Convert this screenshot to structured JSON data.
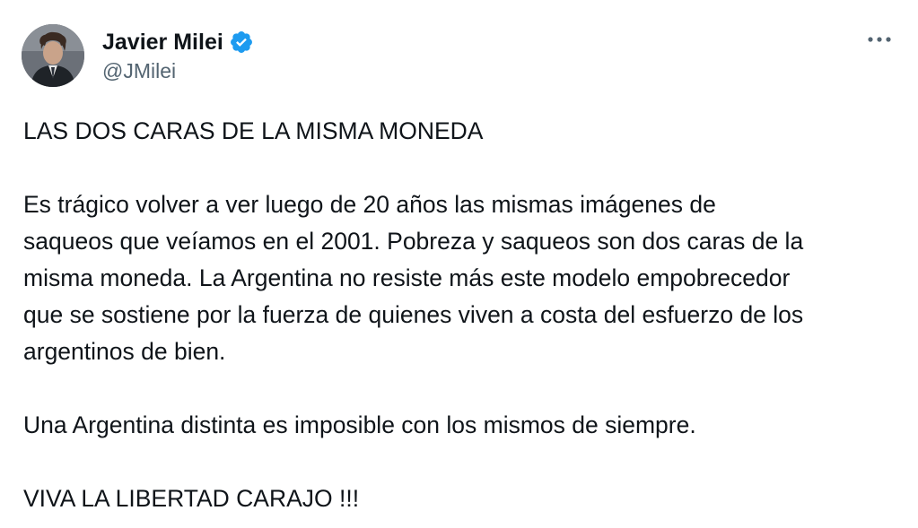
{
  "author": {
    "display_name": "Javier Milei",
    "handle": "@JMilei",
    "verified_icon": "verified-badge-icon",
    "avatar_icon": "avatar"
  },
  "menu": {
    "more_icon": "more-options-icon"
  },
  "colors": {
    "text": "#0f1419",
    "secondary_text": "#536471",
    "verified_blue": "#1d9bf0",
    "background": "#ffffff"
  },
  "tweet": {
    "title": "LAS DOS CARAS DE LA MISMA MONEDA",
    "paragraph_1_lines": [
      "Es trágico volver a ver luego de 20 años las mismas imágenes de",
      "saqueos que veíamos en el 2001. Pobreza y saqueos son dos caras de la",
      "misma moneda. La Argentina no resiste más este modelo empobrecedor",
      "que se sostiene por la fuerza de quienes viven a costa del esfuerzo de los",
      "argentinos de bien."
    ],
    "paragraph_2": "Una Argentina distinta es imposible con los mismos de siempre.",
    "closing": "VIVA LA LIBERTAD CARAJO !!!"
  }
}
